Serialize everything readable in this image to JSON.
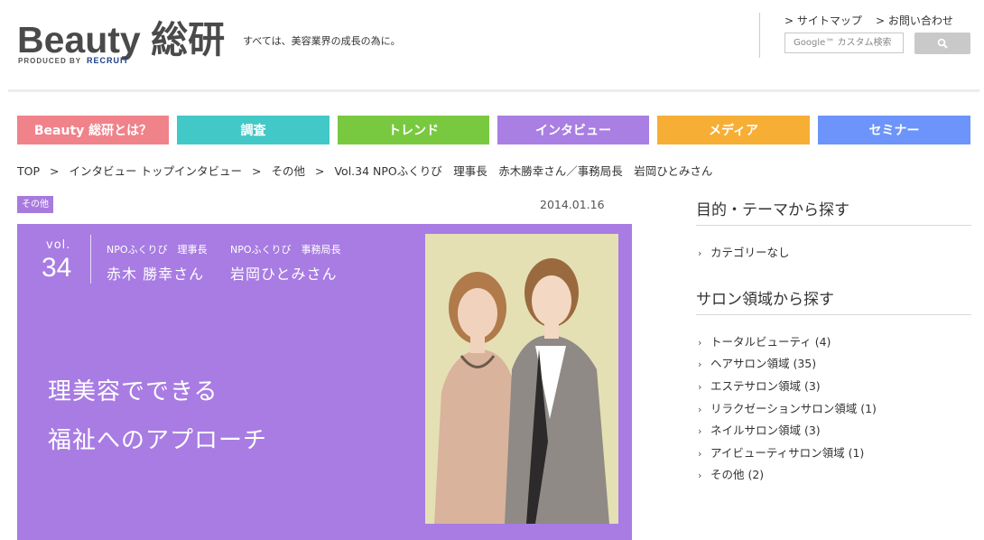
{
  "header": {
    "logo_text": "Beauty 総研",
    "logo_sub_prefix": "PRODUCED BY",
    "logo_sub_brand": "RECRUIT",
    "tagline": "すべては、美容業界の成長の為に。",
    "util_links": [
      {
        "label": "> サイトマップ"
      },
      {
        "label": "> お問い合わせ"
      }
    ],
    "search": {
      "placeholder": "Google™ カスタム検索"
    }
  },
  "nav": {
    "items": [
      {
        "label": "Beauty 総研とは？",
        "color": "#f0828a"
      },
      {
        "label": "調査",
        "color": "#42c8c6"
      },
      {
        "label": "トレンド",
        "color": "#79c940"
      },
      {
        "label": "インタビュー",
        "color": "#a97fe3"
      },
      {
        "label": "メディア",
        "color": "#f7ae35"
      },
      {
        "label": "セミナー",
        "color": "#6c94fa"
      }
    ]
  },
  "breadcrumb": {
    "items": [
      "TOP",
      "インタビュー トップインタビュー",
      "その他",
      "Vol.34 NPOふくりび　理事長　赤木勝幸さん／事務局長　岩岡ひとみさん"
    ],
    "separator": ">"
  },
  "article": {
    "category": "その他",
    "date": "2014.01.16",
    "vol_label": "vol.",
    "vol_number": "34",
    "people": [
      {
        "role": "NPOふくりび　理事長",
        "name": "赤木 勝幸さん"
      },
      {
        "role": "NPOふくりび　事務局長",
        "name": "岩岡ひとみさん"
      }
    ],
    "title_lines": [
      "理美容でできる",
      "福祉へのアプローチ"
    ],
    "accent_color": "#a87ce3"
  },
  "sidebar": {
    "theme_heading": "目的・テーマから探す",
    "theme_items": [
      "カテゴリーなし"
    ],
    "salon_heading": "サロン領域から探す",
    "salon_items": [
      "トータルビューティ (4)",
      "ヘアサロン領域 (35)",
      "エステサロン領域 (3)",
      "リラクゼーションサロン領域 (1)",
      "ネイルサロン領域 (3)",
      "アイビューティサロン領域 (1)",
      "その他 (2)"
    ]
  }
}
